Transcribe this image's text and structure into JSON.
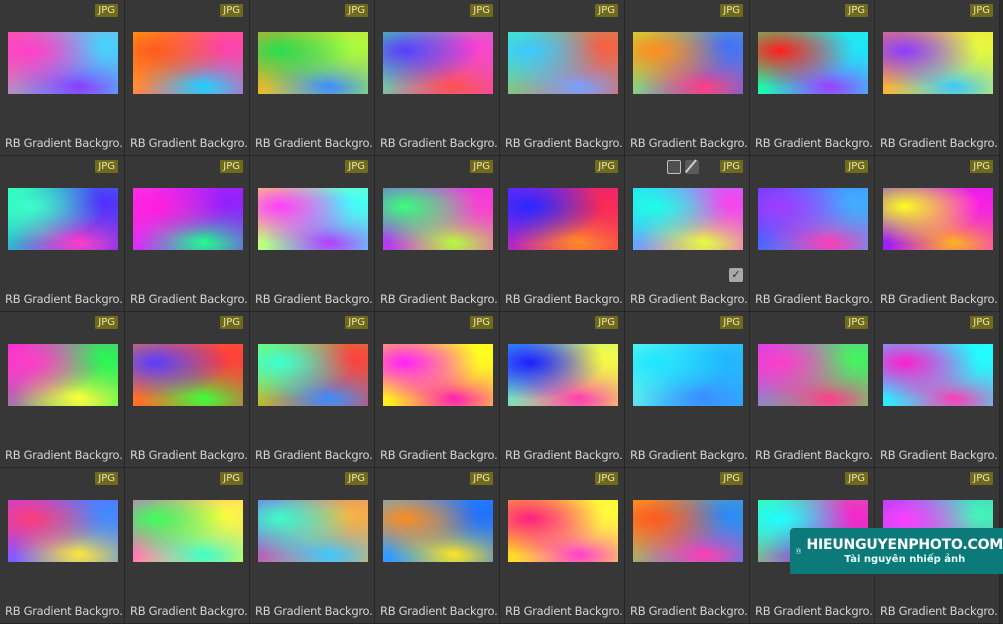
{
  "file_type_badge": "JPG",
  "item_label": "RB Gradient Backgro...",
  "items": [
    {
      "colors": [
        "#ff3fc8",
        "#3fd9ff",
        "#8a3dff",
        "#ff5aa0"
      ]
    },
    {
      "colors": [
        "#ff5a1e",
        "#ff3cb4",
        "#1ed2ff",
        "#ffb400"
      ]
    },
    {
      "colors": [
        "#28dc50",
        "#aaff3c",
        "#3c8cff",
        "#ff9628"
      ]
    },
    {
      "colors": [
        "#5a3cff",
        "#ff3cd2",
        "#ff5050",
        "#3cff8c"
      ]
    },
    {
      "colors": [
        "#3cc8ff",
        "#ff5a3c",
        "#78a0ff",
        "#3cffb4"
      ]
    },
    {
      "colors": [
        "#ff8c1e",
        "#3c6eff",
        "#ff3c82",
        "#b4ff3c"
      ]
    },
    {
      "colors": [
        "#ff1e1e",
        "#1ee6ff",
        "#a03cff",
        "#1eff82"
      ]
    },
    {
      "colors": [
        "#8c3cff",
        "#e6ff3c",
        "#3cc8ff",
        "#ff8c3c"
      ]
    },
    {
      "colors": [
        "#3cffc8",
        "#5028ff",
        "#ff3cc8",
        "#28ffb4"
      ]
    },
    {
      "colors": [
        "#ff1edc",
        "#8c1eff",
        "#1eff8c",
        "#ff3cf0"
      ]
    },
    {
      "colors": [
        "#ff3cff",
        "#3cffff",
        "#b43cff",
        "#ffff3c"
      ]
    },
    {
      "colors": [
        "#3cff78",
        "#ff3cd2",
        "#b4ff3c",
        "#8c3cff"
      ]
    },
    {
      "colors": [
        "#2828ff",
        "#ff2850",
        "#ff8c28",
        "#8c28ff"
      ]
    },
    {
      "colors": [
        "#1effe6",
        "#ff3cf0",
        "#e6ff3c",
        "#1edcff"
      ]
    },
    {
      "colors": [
        "#a03cff",
        "#3cb4ff",
        "#ff3cb4",
        "#5a3cff"
      ]
    },
    {
      "colors": [
        "#ffff1e",
        "#ff1ee6",
        "#ffb41e",
        "#6e1eff"
      ]
    },
    {
      "colors": [
        "#ff3cc8",
        "#1eff50",
        "#ffff3c",
        "#ff1edc"
      ]
    },
    {
      "colors": [
        "#5a3cff",
        "#ff3c3c",
        "#3cff3c",
        "#ff8c1e"
      ]
    },
    {
      "colors": [
        "#3cffd2",
        "#ff3c3c",
        "#3c8cff",
        "#8cff3c"
      ]
    },
    {
      "colors": [
        "#ff1eff",
        "#ffff1e",
        "#ff1eb4",
        "#ffe61e"
      ]
    },
    {
      "colors": [
        "#1e1eff",
        "#ffff3c",
        "#ff3cb4",
        "#3cc8ff"
      ]
    },
    {
      "colors": [
        "#1ee6ff",
        "#1eb4ff",
        "#3c8cff",
        "#78ffe6"
      ]
    },
    {
      "colors": [
        "#ff3cc8",
        "#3cff5a",
        "#ff3c8c",
        "#c83cff"
      ]
    },
    {
      "colors": [
        "#ff1ecd",
        "#1effff",
        "#ff3cb4",
        "#3cdcff"
      ]
    },
    {
      "colors": [
        "#ff3c78",
        "#3c8cff",
        "#ffe63c",
        "#b43cff"
      ]
    },
    {
      "colors": [
        "#3cff5a",
        "#ffff3c",
        "#3cffc8",
        "#ff3cf0"
      ]
    },
    {
      "colors": [
        "#3cffc8",
        "#ffb43c",
        "#3cc8ff",
        "#8c3cff"
      ]
    },
    {
      "colors": [
        "#ff8c1e",
        "#1e6eff",
        "#ffe61e",
        "#3cb4ff"
      ]
    },
    {
      "colors": [
        "#ff1e82",
        "#ffff3c",
        "#ff3cd2",
        "#ffc81e"
      ]
    },
    {
      "colors": [
        "#ff5a1e",
        "#1e8cff",
        "#ff3cb4",
        "#ffb41e"
      ]
    },
    {
      "colors": [
        "#1effff",
        "#ff1ec8",
        "#5a3cff",
        "#3cff8c"
      ]
    },
    {
      "colors": [
        "#ff3cff",
        "#3cffb4",
        "#ff1ed2",
        "#8c3cff"
      ]
    }
  ],
  "selected_index": 13,
  "watermark": {
    "title": "HIEUNGUYENPHOTO.COM",
    "subtitle": "Tài nguyên nhiếp ảnh"
  }
}
